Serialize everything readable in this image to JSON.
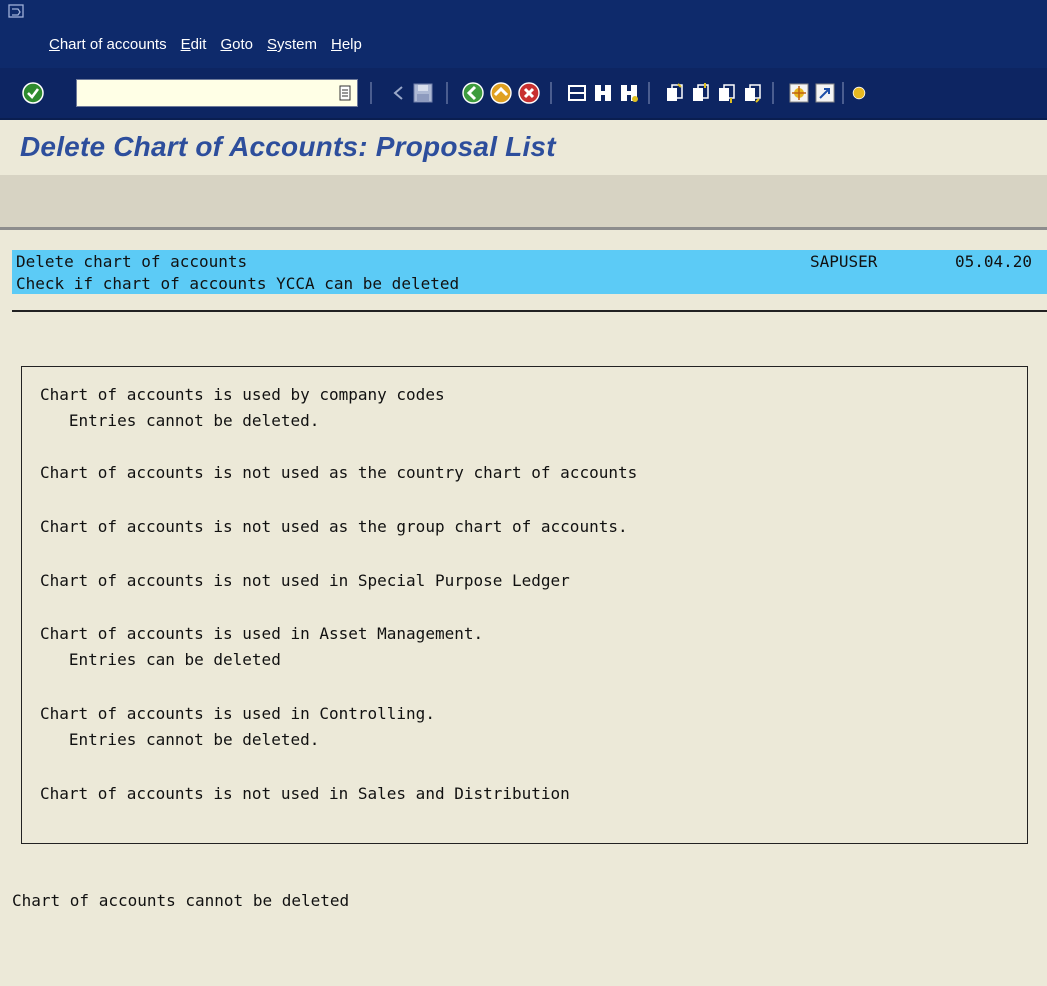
{
  "menubar": {
    "items": [
      {
        "label": "Chart of accounts"
      },
      {
        "label": "Edit"
      },
      {
        "label": "Goto"
      },
      {
        "label": "System"
      },
      {
        "label": "Help"
      }
    ]
  },
  "toolbar": {
    "command_value": "",
    "icons": [
      "enter-icon",
      "command-history-icon",
      "back-arrow-icon",
      "save-icon",
      "back-icon",
      "exit-icon",
      "cancel-icon",
      "print-icon",
      "find-icon",
      "find-next-icon",
      "first-page-icon",
      "previous-page-icon",
      "next-page-icon",
      "last-page-icon",
      "create-session-icon",
      "shortcut-icon",
      "help-icon"
    ]
  },
  "title": "Delete Chart of Accounts: Proposal List",
  "report_header": {
    "line1": "Delete chart of accounts",
    "user": "SAPUSER",
    "date": "05.04.20",
    "line2": "Check if chart of accounts YCCA can be deleted"
  },
  "checks": {
    "l1": "Chart of accounts is used by company codes",
    "l2": "   Entries cannot be deleted.",
    "l3": "Chart of accounts is not used as the country chart of accounts",
    "l4": "Chart of accounts is not used as the group chart of accounts.",
    "l5": "Chart of accounts is not used in Special Purpose Ledger",
    "l6": "Chart of accounts is used in Asset Management.",
    "l7": "   Entries can be deleted",
    "l8": "Chart of accounts is used in Controlling.",
    "l9": "   Entries cannot be deleted.",
    "l10": "Chart of accounts is not used in Sales and Distribution"
  },
  "result": "Chart of accounts cannot be deleted",
  "colors": {
    "menubar": "#0E2A6B",
    "title": "#2D4E9C",
    "header_highlight": "#5CCBF6",
    "background": "#ECE9D8"
  }
}
